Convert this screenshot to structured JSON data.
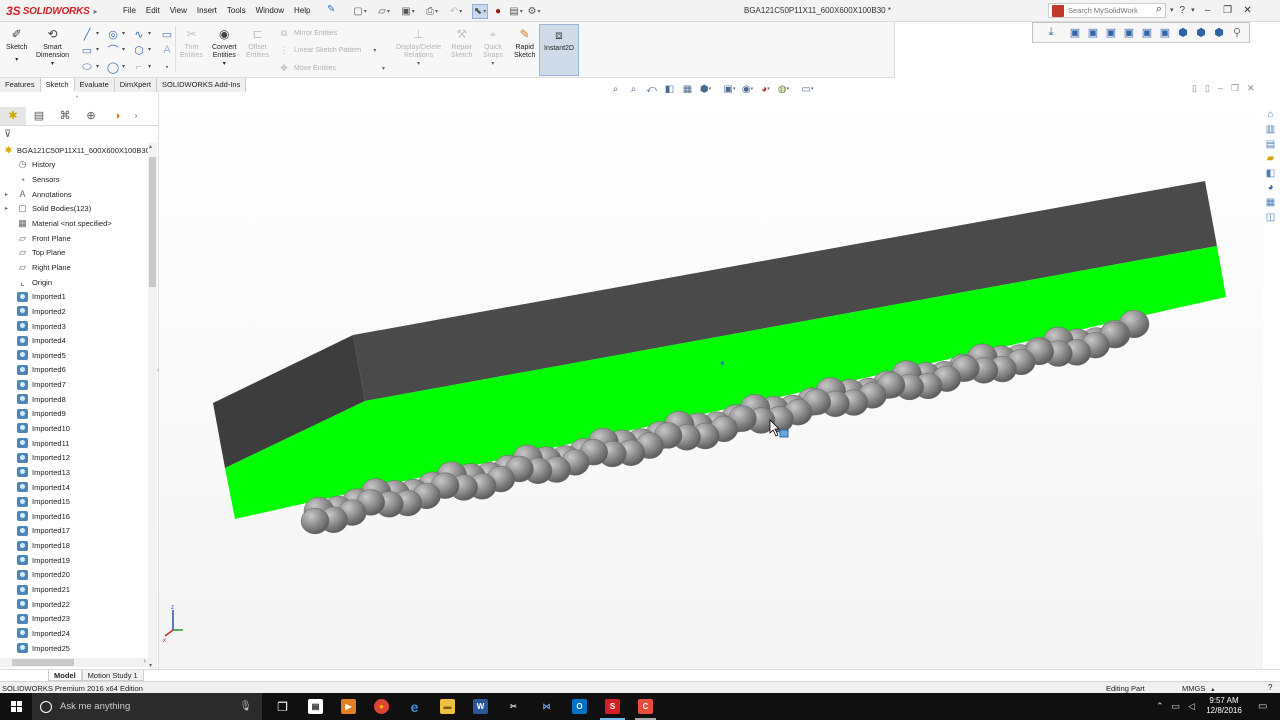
{
  "app": {
    "brand_ds": "3S",
    "brand_name": "SOLIDWORKS",
    "document_title": "BGA121C50P11X11_600X600X100B30 *"
  },
  "menu": [
    "File",
    "Edit",
    "View",
    "Insert",
    "Tools",
    "Window",
    "Help"
  ],
  "search": {
    "placeholder": "Search MySolidWorks"
  },
  "command_manager": {
    "sketch": "Sketch",
    "smart_dimension_1": "Smart",
    "smart_dimension_2": "Dimension",
    "trim_1": "Trim",
    "trim_2": "Entities",
    "convert_1": "Convert",
    "convert_2": "Entities",
    "offset_1": "Offset",
    "offset_2": "Entities",
    "mirror": "Mirror Entities",
    "linear_pattern": "Linear Sketch Pattern",
    "move": "Move Entities",
    "display_delete_1": "Display/Delete",
    "display_delete_2": "Relations",
    "repair_1": "Repair",
    "repair_2": "Sketch",
    "quick_snaps_1": "Quick",
    "quick_snaps_2": "Snaps",
    "rapid_1": "Rapid",
    "rapid_2": "Sketch",
    "instant2d": "Instant2D"
  },
  "tabs": [
    "Features",
    "Sketch",
    "Evaluate",
    "DimXpert",
    "SOLIDWORKS Add-Ins"
  ],
  "active_tab": "Sketch",
  "feature_tree": {
    "root": "BGA121C50P11X11_600X600X100B30",
    "items": [
      {
        "label": "History",
        "icon": "history-icon"
      },
      {
        "label": "Sensors",
        "icon": "sensors-icon"
      },
      {
        "label": "Annotations",
        "icon": "annotations-icon"
      },
      {
        "label": "Solid Bodies(123)",
        "icon": "solid-bodies-icon"
      },
      {
        "label": "Material <not specified>",
        "icon": "material-icon"
      },
      {
        "label": "Front Plane",
        "icon": "plane-icon"
      },
      {
        "label": "Top Plane",
        "icon": "plane-icon"
      },
      {
        "label": "Right Plane",
        "icon": "plane-icon"
      },
      {
        "label": "Origin",
        "icon": "origin-icon"
      },
      {
        "label": "Imported1",
        "icon": "imported-body-icon"
      },
      {
        "label": "Imported2",
        "icon": "imported-body-icon"
      },
      {
        "label": "Imported3",
        "icon": "imported-body-icon"
      },
      {
        "label": "Imported4",
        "icon": "imported-body-icon"
      },
      {
        "label": "Imported5",
        "icon": "imported-body-icon"
      },
      {
        "label": "Imported6",
        "icon": "imported-body-icon"
      },
      {
        "label": "Imported7",
        "icon": "imported-body-icon"
      },
      {
        "label": "Imported8",
        "icon": "imported-body-icon"
      },
      {
        "label": "Imported9",
        "icon": "imported-body-icon"
      },
      {
        "label": "Imported10",
        "icon": "imported-body-icon"
      },
      {
        "label": "Imported11",
        "icon": "imported-body-icon"
      },
      {
        "label": "Imported12",
        "icon": "imported-body-icon"
      },
      {
        "label": "Imported13",
        "icon": "imported-body-icon"
      },
      {
        "label": "Imported14",
        "icon": "imported-body-icon"
      },
      {
        "label": "Imported15",
        "icon": "imported-body-icon"
      },
      {
        "label": "Imported16",
        "icon": "imported-body-icon"
      },
      {
        "label": "Imported17",
        "icon": "imported-body-icon"
      },
      {
        "label": "Imported18",
        "icon": "imported-body-icon"
      },
      {
        "label": "Imported19",
        "icon": "imported-body-icon"
      },
      {
        "label": "Imported20",
        "icon": "imported-body-icon"
      },
      {
        "label": "Imported21",
        "icon": "imported-body-icon"
      },
      {
        "label": "Imported22",
        "icon": "imported-body-icon"
      },
      {
        "label": "Imported23",
        "icon": "imported-body-icon"
      },
      {
        "label": "Imported24",
        "icon": "imported-body-icon"
      },
      {
        "label": "Imported25",
        "icon": "imported-body-icon"
      }
    ]
  },
  "bottom_tabs": [
    "Model",
    "Motion Study 1"
  ],
  "status": {
    "edition": "SOLIDWORKS Premium 2016 x64 Edition",
    "mode": "Editing Part",
    "units": "MMGS"
  },
  "taskbar": {
    "search_placeholder": "Ask me anything",
    "time": "9:57 AM",
    "date": "12/8/2016"
  },
  "colors": {
    "package_top": "#4a4a4a",
    "package_side": "#00ff00",
    "solder_balls": "#8a8a8a",
    "brand_red": "#d51f26"
  }
}
